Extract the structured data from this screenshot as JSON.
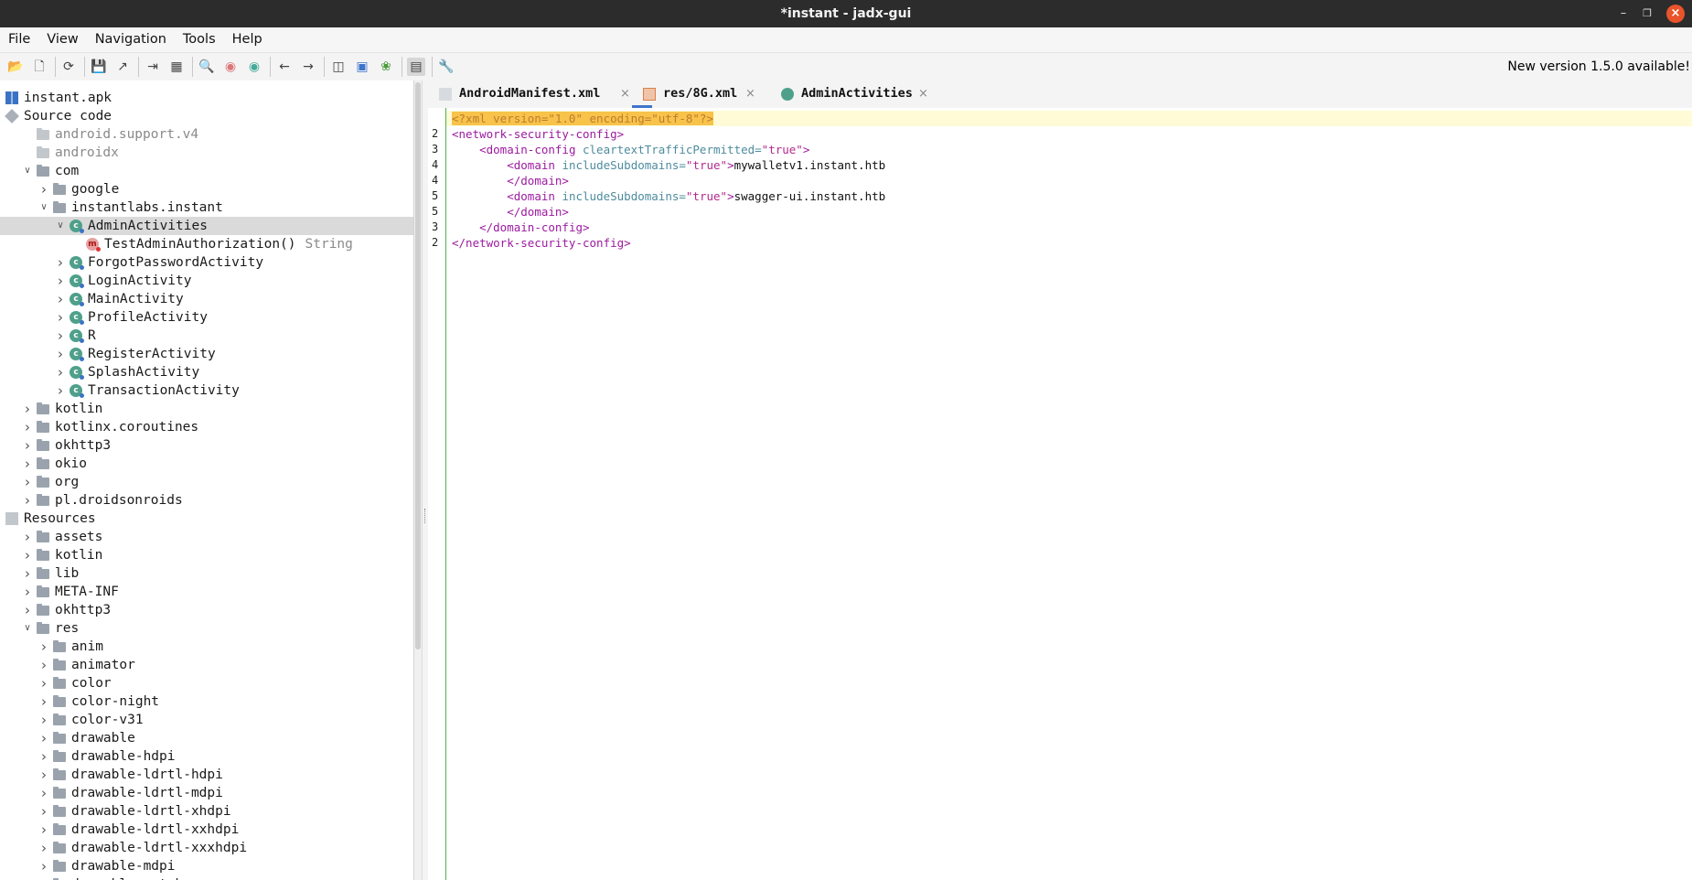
{
  "window": {
    "title": "*instant - jadx-gui"
  },
  "menu": [
    "File",
    "View",
    "Navigation",
    "Tools",
    "Help"
  ],
  "toolbar": {
    "update_notice": "New version 1.5.0 available!"
  },
  "tree": [
    {
      "label": "instant.apk",
      "icon": "apk-icon",
      "indent": 0,
      "expand": ""
    },
    {
      "label": "Source code",
      "icon": "source-code-icon",
      "indent": 0,
      "expand": "open"
    },
    {
      "label": "android.support.v4",
      "icon": "package-icon",
      "indent": 1,
      "expand": "",
      "muted": true
    },
    {
      "label": "androidx",
      "icon": "package-icon",
      "indent": 1,
      "expand": "",
      "muted": true
    },
    {
      "label": "com",
      "icon": "package-icon",
      "indent": 1,
      "expand": "open"
    },
    {
      "label": "google",
      "icon": "package-icon",
      "indent": 2,
      "expand": "closed"
    },
    {
      "label": "instantlabs.instant",
      "icon": "package-icon",
      "indent": 2,
      "expand": "open"
    },
    {
      "label": "AdminActivities",
      "icon": "class-icon",
      "indent": 3,
      "expand": "open",
      "selected": true
    },
    {
      "label": "TestAdminAuthorization()",
      "ret": "String",
      "icon": "method-icon",
      "indent": 4,
      "expand": ""
    },
    {
      "label": "ForgotPasswordActivity",
      "icon": "class-icon",
      "indent": 3,
      "expand": "closed"
    },
    {
      "label": "LoginActivity",
      "icon": "class-icon",
      "indent": 3,
      "expand": "closed"
    },
    {
      "label": "MainActivity",
      "icon": "class-icon",
      "indent": 3,
      "expand": "closed"
    },
    {
      "label": "ProfileActivity",
      "icon": "class-icon",
      "indent": 3,
      "expand": "closed"
    },
    {
      "label": "R",
      "icon": "class-icon",
      "indent": 3,
      "expand": "closed"
    },
    {
      "label": "RegisterActivity",
      "icon": "class-icon",
      "indent": 3,
      "expand": "closed"
    },
    {
      "label": "SplashActivity",
      "icon": "class-icon",
      "indent": 3,
      "expand": "closed"
    },
    {
      "label": "TransactionActivity",
      "icon": "class-icon",
      "indent": 3,
      "expand": "closed"
    },
    {
      "label": "kotlin",
      "icon": "package-icon",
      "indent": 1,
      "expand": "closed"
    },
    {
      "label": "kotlinx.coroutines",
      "icon": "package-icon",
      "indent": 1,
      "expand": "closed"
    },
    {
      "label": "okhttp3",
      "icon": "package-icon",
      "indent": 1,
      "expand": "closed"
    },
    {
      "label": "okio",
      "icon": "package-icon",
      "indent": 1,
      "expand": "closed"
    },
    {
      "label": "org",
      "icon": "package-icon",
      "indent": 1,
      "expand": "closed"
    },
    {
      "label": "pl.droidsonroids",
      "icon": "package-icon",
      "indent": 1,
      "expand": "closed"
    },
    {
      "label": "Resources",
      "icon": "resources-icon",
      "indent": 0,
      "expand": "open"
    },
    {
      "label": "assets",
      "icon": "folder-icon",
      "indent": 1,
      "expand": "closed"
    },
    {
      "label": "kotlin",
      "icon": "folder-icon",
      "indent": 1,
      "expand": "closed"
    },
    {
      "label": "lib",
      "icon": "folder-icon",
      "indent": 1,
      "expand": "closed"
    },
    {
      "label": "META-INF",
      "icon": "folder-icon",
      "indent": 1,
      "expand": "closed"
    },
    {
      "label": "okhttp3",
      "icon": "folder-icon",
      "indent": 1,
      "expand": "closed"
    },
    {
      "label": "res",
      "icon": "folder-icon",
      "indent": 1,
      "expand": "open"
    },
    {
      "label": "anim",
      "icon": "folder-icon",
      "indent": 2,
      "expand": "closed"
    },
    {
      "label": "animator",
      "icon": "folder-icon",
      "indent": 2,
      "expand": "closed"
    },
    {
      "label": "color",
      "icon": "folder-icon",
      "indent": 2,
      "expand": "closed"
    },
    {
      "label": "color-night",
      "icon": "folder-icon",
      "indent": 2,
      "expand": "closed"
    },
    {
      "label": "color-v31",
      "icon": "folder-icon",
      "indent": 2,
      "expand": "closed"
    },
    {
      "label": "drawable",
      "icon": "folder-icon",
      "indent": 2,
      "expand": "closed"
    },
    {
      "label": "drawable-hdpi",
      "icon": "folder-icon",
      "indent": 2,
      "expand": "closed"
    },
    {
      "label": "drawable-ldrtl-hdpi",
      "icon": "folder-icon",
      "indent": 2,
      "expand": "closed"
    },
    {
      "label": "drawable-ldrtl-mdpi",
      "icon": "folder-icon",
      "indent": 2,
      "expand": "closed"
    },
    {
      "label": "drawable-ldrtl-xhdpi",
      "icon": "folder-icon",
      "indent": 2,
      "expand": "closed"
    },
    {
      "label": "drawable-ldrtl-xxhdpi",
      "icon": "folder-icon",
      "indent": 2,
      "expand": "closed"
    },
    {
      "label": "drawable-ldrtl-xxxhdpi",
      "icon": "folder-icon",
      "indent": 2,
      "expand": "closed"
    },
    {
      "label": "drawable-mdpi",
      "icon": "folder-icon",
      "indent": 2,
      "expand": "closed"
    },
    {
      "label": "drawable-watch",
      "icon": "folder-icon",
      "indent": 2,
      "expand": "closed"
    }
  ],
  "tabs": [
    {
      "label": "AndroidManifest.xml",
      "icon": "manifest-file-icon",
      "active": false
    },
    {
      "label": "res/8G.xml",
      "icon": "xml-file-icon",
      "active": true
    },
    {
      "label": "AdminActivities",
      "icon": "class-icon",
      "active": false
    }
  ],
  "code": [
    {
      "ln": "",
      "html": "decl",
      "text": "<?xml version=\"1.0\" encoding=\"utf-8\"?>"
    },
    {
      "ln": "2",
      "parts": [
        [
          "tg",
          "<network-security-config>"
        ]
      ]
    },
    {
      "ln": "3",
      "parts": [
        [
          "tx",
          "    "
        ],
        [
          "tg",
          "<domain-config "
        ],
        [
          "at",
          "cleartextTrafficPermitted="
        ],
        [
          "vl",
          "\"true\""
        ],
        [
          "tg",
          ">"
        ]
      ]
    },
    {
      "ln": "4",
      "parts": [
        [
          "tx",
          "        "
        ],
        [
          "tg",
          "<domain "
        ],
        [
          "at",
          "includeSubdomains="
        ],
        [
          "vl",
          "\"true\""
        ],
        [
          "tg",
          ">"
        ],
        [
          "tx",
          "mywalletv1.instant.htb"
        ]
      ]
    },
    {
      "ln": "4",
      "parts": [
        [
          "tx",
          "        "
        ],
        [
          "tg",
          "</domain>"
        ]
      ]
    },
    {
      "ln": "5",
      "parts": [
        [
          "tx",
          "        "
        ],
        [
          "tg",
          "<domain "
        ],
        [
          "at",
          "includeSubdomains="
        ],
        [
          "vl",
          "\"true\""
        ],
        [
          "tg",
          ">"
        ],
        [
          "tx",
          "swagger-ui.instant.htb"
        ]
      ]
    },
    {
      "ln": "5",
      "parts": [
        [
          "tx",
          "        "
        ],
        [
          "tg",
          "</domain>"
        ]
      ]
    },
    {
      "ln": "3",
      "parts": [
        [
          "tx",
          "    "
        ],
        [
          "tg",
          "</domain-config>"
        ]
      ]
    },
    {
      "ln": "2",
      "parts": [
        [
          "tg",
          "</network-security-config>"
        ]
      ]
    }
  ]
}
